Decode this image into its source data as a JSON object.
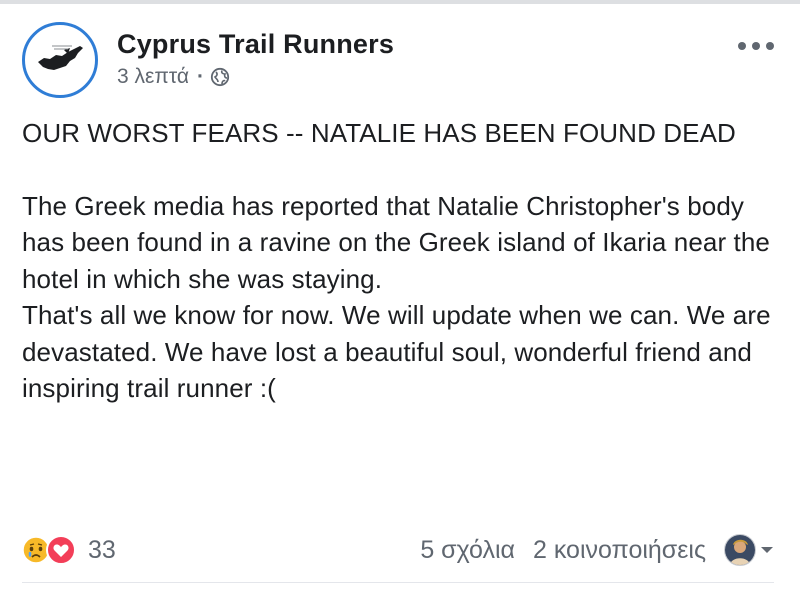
{
  "post": {
    "page_name": "Cyprus Trail Runners",
    "timestamp": "3 λεπτά",
    "separator": "·",
    "privacy_icon": "globe-icon",
    "more_icon": "ellipsis-icon",
    "headline": "OUR WORST FEARS -- NATALIE HAS BEEN FOUND DEAD",
    "body": [
      "The Greek media has reported that Natalie Christopher's body has been found in a ravine on the Greek island of Ikaria near the hotel in which she was staying.",
      "That's all we know for now. We will update when we can. We are devastated. We have lost a beautiful soul, wonderful friend and inspiring trail runner :("
    ]
  },
  "footer": {
    "reaction_icons": [
      "sad-icon",
      "love-icon"
    ],
    "reaction_count": "33",
    "comments": "5 σχόλια",
    "shares": "2 κοινοποιήσεις"
  },
  "colors": {
    "avatar_ring": "#2f7dd6",
    "text_primary": "#1c1e21",
    "text_secondary": "#606770",
    "love": "#f33e58",
    "sad": "#f7b928"
  }
}
